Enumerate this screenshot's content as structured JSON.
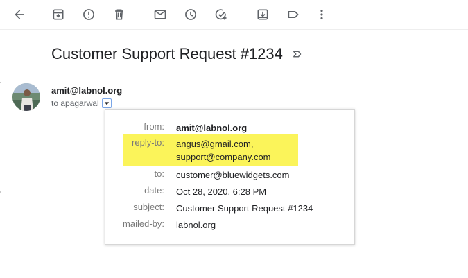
{
  "toolbar": {
    "icons": [
      "back-arrow-icon",
      "archive-icon",
      "report-spam-icon",
      "delete-icon",
      "mark-unread-icon",
      "snooze-icon",
      "add-to-tasks-icon",
      "move-to-icon",
      "label-icon",
      "more-options-icon"
    ]
  },
  "email": {
    "subject": "Customer Support Request #1234",
    "sender": "amit@labnol.org",
    "to_line": "to apagarwal"
  },
  "details": {
    "rows": [
      {
        "label": "from:",
        "value": "amit@labnol.org"
      },
      {
        "label": "reply-to:",
        "value": "angus@gmail.com,",
        "value2": "support@company.com"
      },
      {
        "label": "to:",
        "value": "customer@bluewidgets.com"
      },
      {
        "label": "date:",
        "value": "Oct 28, 2020, 6:28 PM"
      },
      {
        "label": "subject:",
        "value": "Customer Support Request #1234"
      },
      {
        "label": "mailed-by:",
        "value": "labnol.org"
      }
    ]
  },
  "colors": {
    "highlight": "#fbf45a",
    "icon": "#5f6368",
    "label_text": "#7a7a7a"
  }
}
